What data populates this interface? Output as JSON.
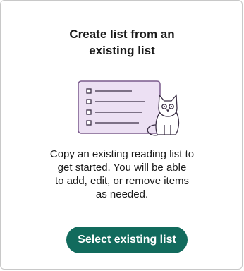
{
  "card": {
    "title": "Create list from an existing list",
    "description": "Copy an existing reading list to get started. You will be able to add, edit, or remove items as needed.",
    "button_label": "Select existing list"
  },
  "illustration": {
    "icon": "list-with-cat-illustration",
    "colors": {
      "panel_fill": "#ece0f3",
      "panel_stroke": "#7a5a8c",
      "cat_fill": "#ffffff",
      "cat_stroke": "#3b2f45"
    }
  },
  "colors": {
    "button_bg": "#126b5d",
    "button_text": "#ffffff",
    "border": "#c8c8c8"
  }
}
